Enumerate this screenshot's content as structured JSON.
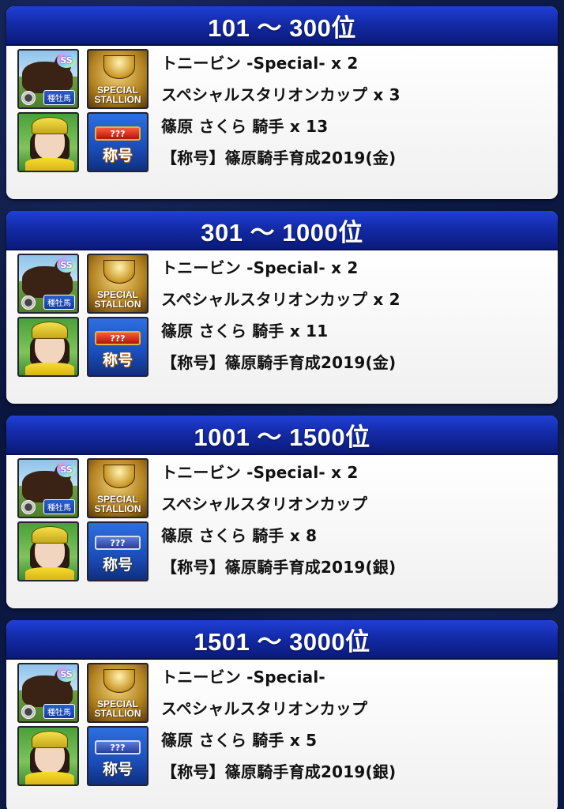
{
  "sections": [
    {
      "range": "101 〜 300位",
      "title_badge": "gold",
      "rewards": [
        "トニービン -Special- x 2",
        "スペシャルスタリオンカップ x 3",
        "篠原 さくら 騎手 x 13",
        "【称号】篠原騎手育成2019(金)"
      ]
    },
    {
      "range": "301 〜 1000位",
      "title_badge": "gold",
      "rewards": [
        "トニービン -Special- x 2",
        "スペシャルスタリオンカップ x 2",
        "篠原 さくら 騎手 x 11",
        "【称号】篠原騎手育成2019(金)"
      ]
    },
    {
      "range": "1001 〜 1500位",
      "title_badge": "silver",
      "rewards": [
        "トニービン -Special- x 2",
        "スペシャルスタリオンカップ",
        "篠原 さくら 騎手 x 8",
        "【称号】篠原騎手育成2019(銀)"
      ]
    },
    {
      "range": "1501 〜 3000位",
      "title_badge": "silver",
      "rewards": [
        "トニービン -Special-",
        "スペシャルスタリオンカップ",
        "篠原 さくら 騎手 x 5",
        "【称号】篠原騎手育成2019(銀)"
      ]
    }
  ],
  "icons": {
    "ss_badge": "SS",
    "horse_label": "種牡馬",
    "stallion_text_1": "SPECIAL",
    "stallion_text_2": "STALLION",
    "title_question": "???",
    "title_kanji": "称号"
  }
}
